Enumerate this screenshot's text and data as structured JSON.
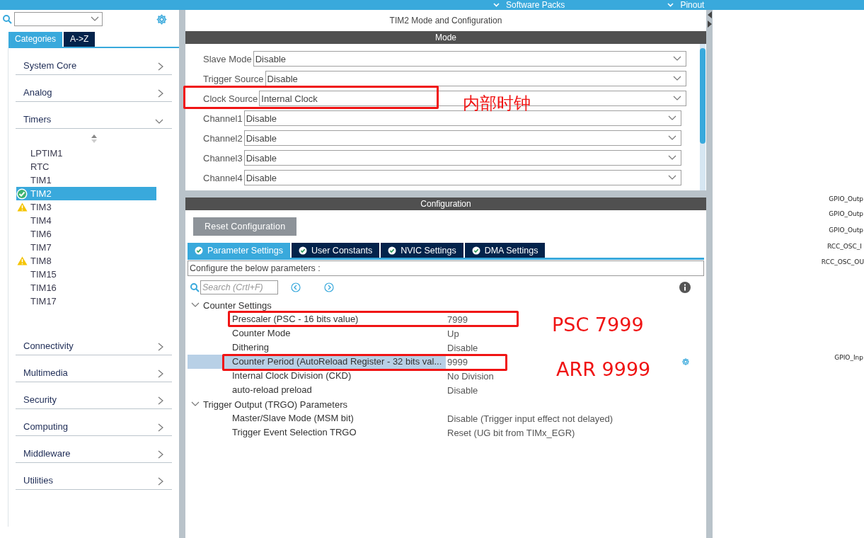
{
  "top_bar": {
    "tabs": [
      {
        "label": "Software Packs"
      },
      {
        "label": "Pinout"
      }
    ]
  },
  "sidebar": {
    "tabs": [
      {
        "label": "Categories",
        "selected": true
      },
      {
        "label": "A->Z",
        "selected": false
      }
    ],
    "categories": [
      {
        "label": "System Core",
        "expanded": false
      },
      {
        "label": "Analog",
        "expanded": false
      },
      {
        "label": "Timers",
        "expanded": true,
        "children": [
          {
            "label": "LPTIM1",
            "selected": false,
            "kind": "plain"
          },
          {
            "label": "RTC",
            "selected": false,
            "kind": "plain"
          },
          {
            "label": "TIM1",
            "selected": false,
            "kind": "plain"
          },
          {
            "label": "TIM2",
            "selected": true,
            "kind": "ok"
          },
          {
            "label": "TIM3",
            "selected": false,
            "kind": "warning"
          },
          {
            "label": "TIM4",
            "selected": false,
            "kind": "plain"
          },
          {
            "label": "TIM6",
            "selected": false,
            "kind": "plain"
          },
          {
            "label": "TIM7",
            "selected": false,
            "kind": "plain"
          },
          {
            "label": "TIM8",
            "selected": false,
            "kind": "warning"
          },
          {
            "label": "TIM15",
            "selected": false,
            "kind": "plain"
          },
          {
            "label": "TIM16",
            "selected": false,
            "kind": "plain"
          },
          {
            "label": "TIM17",
            "selected": false,
            "kind": "plain"
          }
        ]
      },
      {
        "label": "Connectivity",
        "expanded": false
      },
      {
        "label": "Multimedia",
        "expanded": false
      },
      {
        "label": "Security",
        "expanded": false
      },
      {
        "label": "Computing",
        "expanded": false
      },
      {
        "label": "Middleware",
        "expanded": false
      },
      {
        "label": "Utilities",
        "expanded": false
      }
    ]
  },
  "panel": {
    "title": "TIM2 Mode and Configuration",
    "mode": {
      "header": "Mode",
      "rows": [
        {
          "label": "Slave Mode",
          "value": "Disable"
        },
        {
          "label": "Trigger Source",
          "value": "Disable"
        },
        {
          "label": "Clock Source",
          "value": "Internal Clock"
        },
        {
          "label": "Channel1",
          "value": "Disable"
        },
        {
          "label": "Channel2",
          "value": "Disable"
        },
        {
          "label": "Channel3",
          "value": "Disable"
        },
        {
          "label": "Channel4",
          "value": "Disable"
        }
      ]
    },
    "configuration": {
      "header": "Configuration",
      "reset_button": "Reset Configuration",
      "tabs": [
        {
          "label": "Parameter Settings",
          "selected": true
        },
        {
          "label": "User Constants",
          "selected": false
        },
        {
          "label": "NVIC Settings",
          "selected": false
        },
        {
          "label": "DMA Settings",
          "selected": false
        }
      ],
      "hint": "Configure the below parameters :",
      "search": {
        "placeholder": "Search (Crtl+F)"
      },
      "groups": [
        {
          "label": "Counter Settings",
          "expanded": true,
          "children": [
            {
              "label": "Prescaler (PSC - 16 bits value)",
              "value": "7999",
              "selected": false
            },
            {
              "label": "Counter Mode",
              "value": "Up",
              "selected": false
            },
            {
              "label": "Dithering",
              "value": "Disable",
              "selected": false
            },
            {
              "label": "Counter Period (AutoReload Register - 32 bits val...",
              "value": "9999",
              "selected": true
            },
            {
              "label": "Internal Clock Division (CKD)",
              "value": "No Division",
              "selected": false
            },
            {
              "label": "auto-reload preload",
              "value": "Disable",
              "selected": false
            }
          ]
        },
        {
          "label": "Trigger Output (TRGO) Parameters",
          "expanded": true,
          "children": [
            {
              "label": "Master/Slave Mode (MSM bit)",
              "value": "Disable (Trigger input effect not delayed)",
              "selected": false
            },
            {
              "label": "Trigger Event Selection TRGO",
              "value": "Reset (UG bit from TIMx_EGR)",
              "selected": false
            }
          ]
        }
      ]
    }
  },
  "pinout": {
    "labels": [
      "GPIO_Outp",
      "GPIO_Outp",
      "GPIO_Outp",
      "RCC_OSC_I",
      "RCC_OSC_OU",
      "GPIO_Inp"
    ]
  },
  "annotations": [
    "内部时钟",
    "PSC 7999",
    "ARR 9999"
  ]
}
